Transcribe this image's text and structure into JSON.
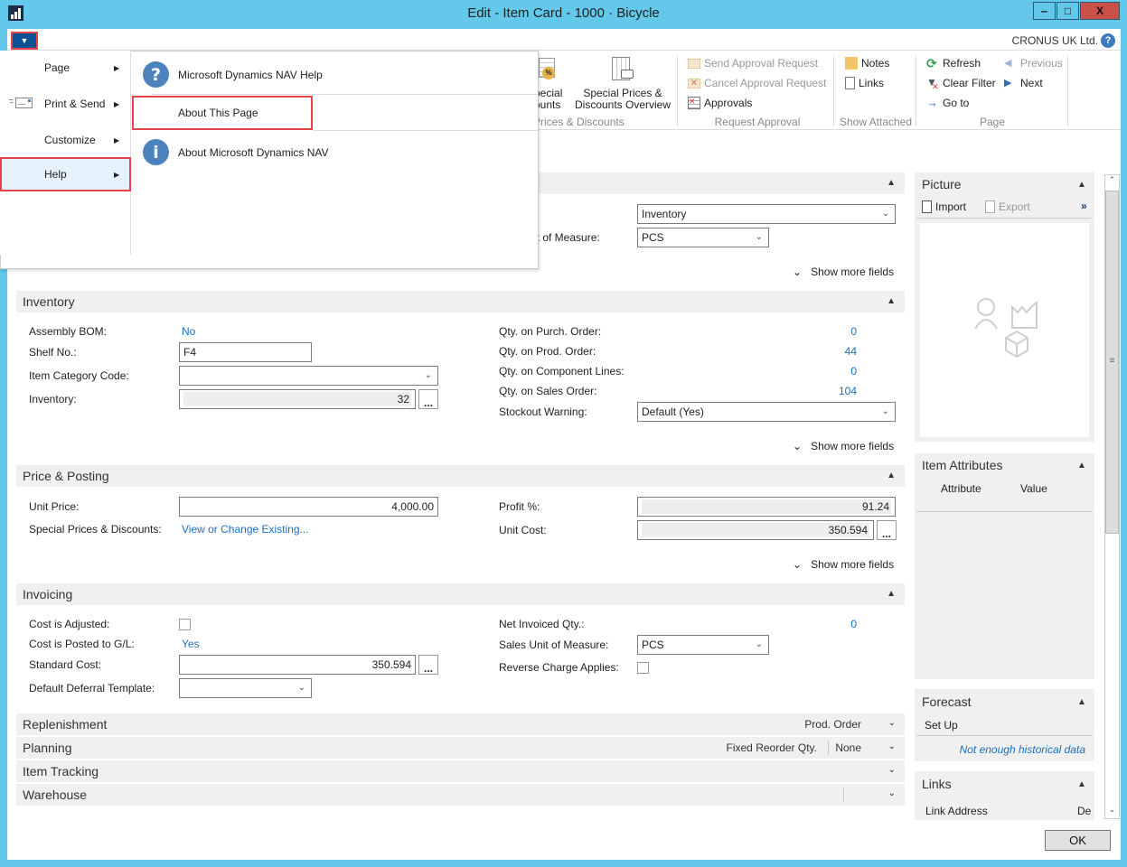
{
  "window": {
    "title": "Edit - Item Card - 1000 · Bicycle",
    "minimize": "‒",
    "maximize": "□",
    "close": "X",
    "company": "CRONUS UK Ltd."
  },
  "app_menu": {
    "button_glyph": "▼",
    "items": [
      {
        "label": "Page",
        "icon": "none"
      },
      {
        "label": "Print & Send",
        "icon": "envelope-icon"
      },
      {
        "label": "Customize",
        "icon": "none"
      },
      {
        "label": "Help",
        "icon": "none",
        "active": true
      }
    ],
    "submenu": [
      {
        "label": "Microsoft Dynamics NAV Help",
        "icon": "question-icon",
        "glyph": "?"
      },
      {
        "label": "About This Page",
        "icon": "none",
        "highlighted": true
      },
      {
        "label": "About Microsoft Dynamics NAV",
        "icon": "info-icon",
        "glyph": "i"
      }
    ]
  },
  "ribbon": {
    "prices_group": {
      "special_partial_line1": "pecial",
      "special_partial_line2": "ounts",
      "overview_line1": "Special Prices &",
      "overview_line2": "Discounts Overview",
      "label": "Prices & Discounts"
    },
    "request_approval": {
      "send": "Send Approval Request",
      "cancel": "Cancel Approval Request",
      "approvals": "Approvals",
      "label": "Request Approval"
    },
    "show_attached": {
      "notes": "Notes",
      "links": "Links",
      "label": "Show Attached"
    },
    "page": {
      "refresh": "Refresh",
      "clear_filter": "Clear Filter",
      "go_to": "Go to",
      "previous": "Previous",
      "next": "Next",
      "label": "Page"
    }
  },
  "general": {
    "type_value": "Inventory",
    "base_uom_label_partial": "it of Measure:",
    "base_uom_value": "PCS",
    "show_more": "Show more fields"
  },
  "inventory": {
    "title": "Inventory",
    "assembly_bom_label": "Assembly BOM:",
    "assembly_bom_value": "No",
    "shelf_no_label": "Shelf No.:",
    "shelf_no_value": "F4",
    "item_category_label": "Item Category Code:",
    "item_category_value": "",
    "inventory_label": "Inventory:",
    "inventory_value": "32",
    "qty_purch_label": "Qty. on Purch. Order:",
    "qty_purch_value": "0",
    "qty_prod_label": "Qty. on Prod. Order:",
    "qty_prod_value": "44",
    "qty_comp_label": "Qty. on Component Lines:",
    "qty_comp_value": "0",
    "qty_sales_label": "Qty. on Sales Order:",
    "qty_sales_value": "104",
    "stockout_label": "Stockout Warning:",
    "stockout_value": "Default (Yes)",
    "show_more": "Show more fields"
  },
  "price_posting": {
    "title": "Price & Posting",
    "unit_price_label": "Unit Price:",
    "unit_price_value": "4,000.00",
    "special_label": "Special Prices & Discounts:",
    "special_link": "View or Change Existing...",
    "profit_label": "Profit %:",
    "profit_value": "91.24",
    "unit_cost_label": "Unit Cost:",
    "unit_cost_value": "350.594",
    "show_more": "Show more fields"
  },
  "invoicing": {
    "title": "Invoicing",
    "cost_adjusted_label": "Cost is Adjusted:",
    "cost_adjusted_checked": false,
    "cost_posted_label": "Cost is Posted to G/L:",
    "cost_posted_value": "Yes",
    "standard_cost_label": "Standard Cost:",
    "standard_cost_value": "350.594",
    "deferral_label": "Default Deferral Template:",
    "deferral_value": "",
    "net_invoiced_label": "Net Invoiced Qty.:",
    "net_invoiced_value": "0",
    "sales_uom_label": "Sales Unit of Measure:",
    "sales_uom_value": "PCS",
    "reverse_charge_label": "Reverse Charge Applies:",
    "reverse_charge_checked": false
  },
  "collapsed_sections": [
    {
      "title": "Replenishment",
      "summary": [
        "Prod. Order"
      ]
    },
    {
      "title": "Planning",
      "summary": [
        "Fixed Reorder Qty.",
        "None"
      ]
    },
    {
      "title": "Item Tracking",
      "summary": []
    },
    {
      "title": "Warehouse",
      "summary": [
        ""
      ]
    }
  ],
  "factbox": {
    "picture": {
      "title": "Picture",
      "import": "Import",
      "export": "Export",
      "more": "»"
    },
    "attributes": {
      "title": "Item Attributes",
      "col_attribute": "Attribute",
      "col_value": "Value"
    },
    "forecast": {
      "title": "Forecast",
      "setup": "Set Up",
      "message": "Not enough historical data"
    },
    "links": {
      "title": "Links",
      "col_address": "Link Address",
      "col_desc_partial": "De"
    }
  },
  "footer": {
    "ok": "OK"
  },
  "colors": {
    "titlebar": "#64c8ea",
    "accent_blue": "#0f4f94",
    "link_blue": "#1a6fc4",
    "highlight_red": "#e8434a",
    "close_red": "#c9514a"
  }
}
